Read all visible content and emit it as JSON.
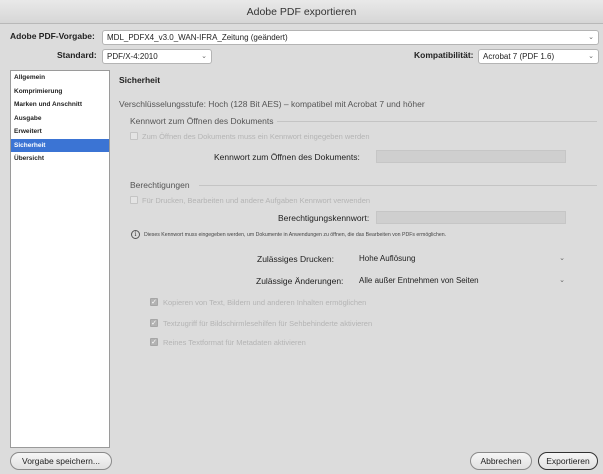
{
  "window": {
    "title": "Adobe PDF exportieren"
  },
  "header": {
    "preset_label": "Adobe PDF-Vorgabe:",
    "preset_value": "MDL_PDFX4_v3.0_WAN-IFRA_Zeitung (geändert)",
    "standard_label": "Standard:",
    "standard_value": "PDF/X-4:2010",
    "compat_label": "Kompatibilität:",
    "compat_value": "Acrobat 7 (PDF 1.6)"
  },
  "sidebar": {
    "items": [
      {
        "label": "Allgemein"
      },
      {
        "label": "Komprimierung"
      },
      {
        "label": "Marken und Anschnitt"
      },
      {
        "label": "Ausgabe"
      },
      {
        "label": "Erweitert"
      },
      {
        "label": "Sicherheit",
        "active": true
      },
      {
        "label": "Übersicht"
      }
    ]
  },
  "main": {
    "section_title": "Sicherheit",
    "encryption_text": "Verschlüsselungsstufe: Hoch (128 Bit AES) – kompatibel mit Acrobat 7 und höher",
    "open_pw": {
      "group_title": "Kennwort zum Öffnen des Dokuments",
      "checkbox_label": "Zum Öffnen des Dokuments muss ein Kennwort eingegeben werden",
      "field_label": "Kennwort zum Öffnen des Dokuments:"
    },
    "permissions": {
      "group_title": "Berechtigungen",
      "checkbox_label": "Für Drucken, Bearbeiten und andere Aufgaben Kennwort verwenden",
      "field_label": "Berechtigungskennwort:",
      "info_text": "Dieses Kennwort muss eingegeben werden, um Dokumente in Anwendungen zu öffnen, die das Bearbeiten von PDFs ermöglichen.",
      "printing_label": "Zulässiges Drucken:",
      "printing_value": "Hohe Auflösung",
      "changes_label": "Zulässige Änderungen:",
      "changes_value": "Alle außer Entnehmen von Seiten",
      "options": [
        {
          "label": "Kopieren von Text, Bildern und anderen Inhalten ermöglichen"
        },
        {
          "label": "Textzugriff für Bildschirmlesehilfen für Sehbehinderte aktivieren"
        },
        {
          "label": "Reines Textformat für Metadaten aktivieren"
        }
      ]
    }
  },
  "footer": {
    "save_preset_label": "Vorgabe speichern...",
    "cancel_label": "Abbrechen",
    "export_label": "Exportieren"
  },
  "icons": {
    "chevron": "chevron-down-icon",
    "info": "info-icon",
    "check": "checkmark-icon"
  }
}
